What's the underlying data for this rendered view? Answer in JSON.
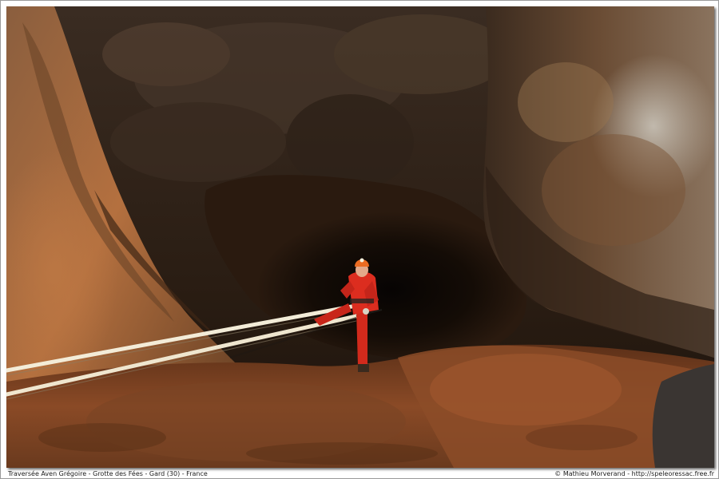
{
  "photo": {
    "subject": "cave-rappel-scene",
    "colors": {
      "cave_dark": "#140d07",
      "rock_orange": "#b0673a",
      "rock_brown": "#6e4a30",
      "suit_red": "#d82a1c",
      "helmet_orange": "#e96a20",
      "rope": "#f2ebd6"
    }
  },
  "caption": {
    "location": "Traversée Aven Grégoire - Grotte des Fées - Gard (30) - France",
    "credit": "© Mathieu Morverand - http://speleoressac.free.fr"
  }
}
